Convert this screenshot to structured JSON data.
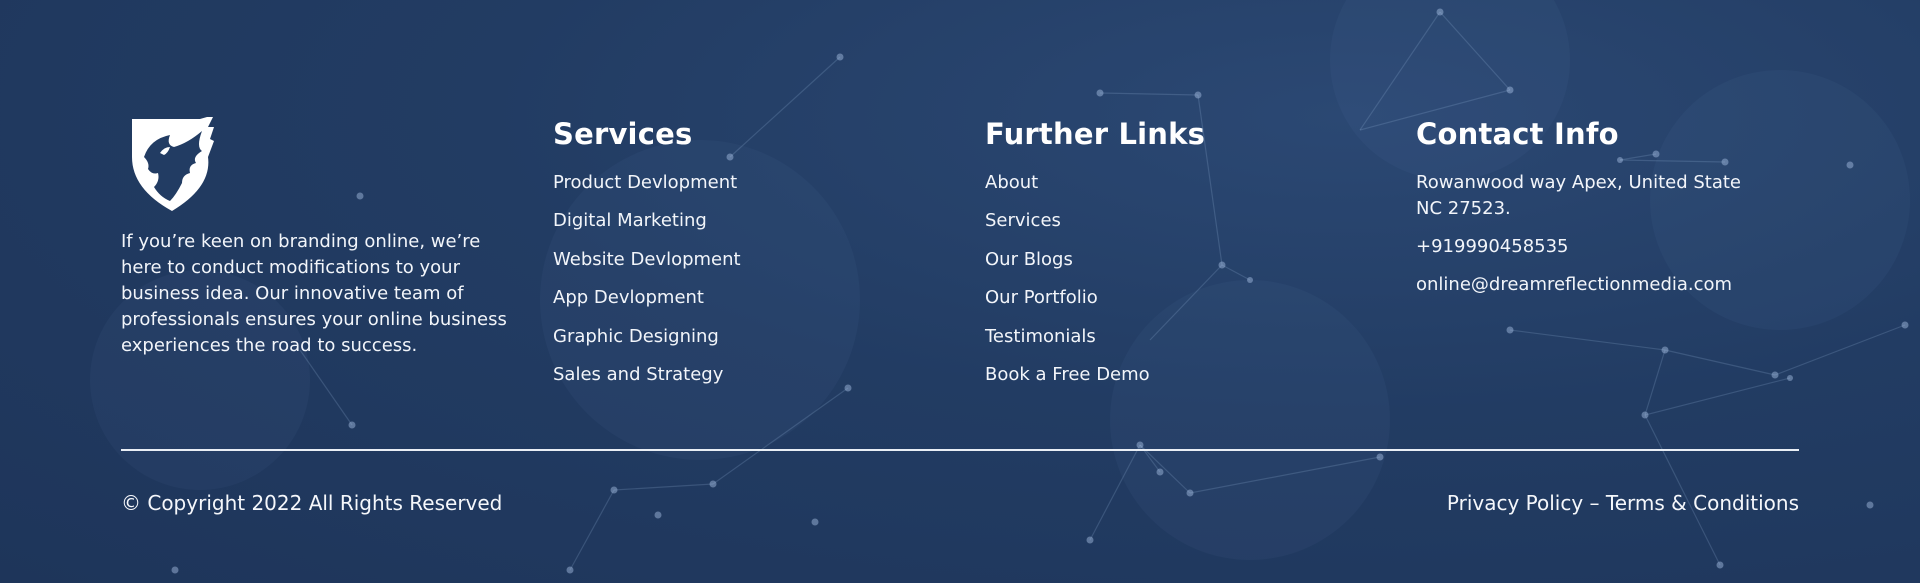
{
  "brand": {
    "logo_icon": "pegasus-shield-logo",
    "about_text": "If you’re keen on branding online, we’re here to conduct modifications to your business idea. Our innovative team of professionals ensures your online business experiences the road to success."
  },
  "services": {
    "title": "Services",
    "items": [
      "Product Devlopment",
      "Digital Marketing",
      "Website Devlopment",
      "App Devlopment",
      "Graphic Designing",
      "Sales and Strategy"
    ]
  },
  "further_links": {
    "title": "Further Links",
    "items": [
      "About",
      "Services",
      "Our Blogs",
      "Our Portfolio",
      "Testimonials",
      "Book a Free Demo"
    ]
  },
  "contact": {
    "title": "Contact Info",
    "address": "Rowanwood way Apex, United State NC 27523.",
    "phone": "+919990458535",
    "email": "online@dreamreflectionmedia.com"
  },
  "bottom_bar": {
    "copyright": "© Copyright 2022 All Rights Reserved",
    "privacy_label": "Privacy Policy",
    "separator": " – ",
    "terms_label": "Terms & Conditions"
  },
  "colors": {
    "background": "#223c63",
    "text": "#ffffff",
    "divider": "#e9eef5"
  }
}
